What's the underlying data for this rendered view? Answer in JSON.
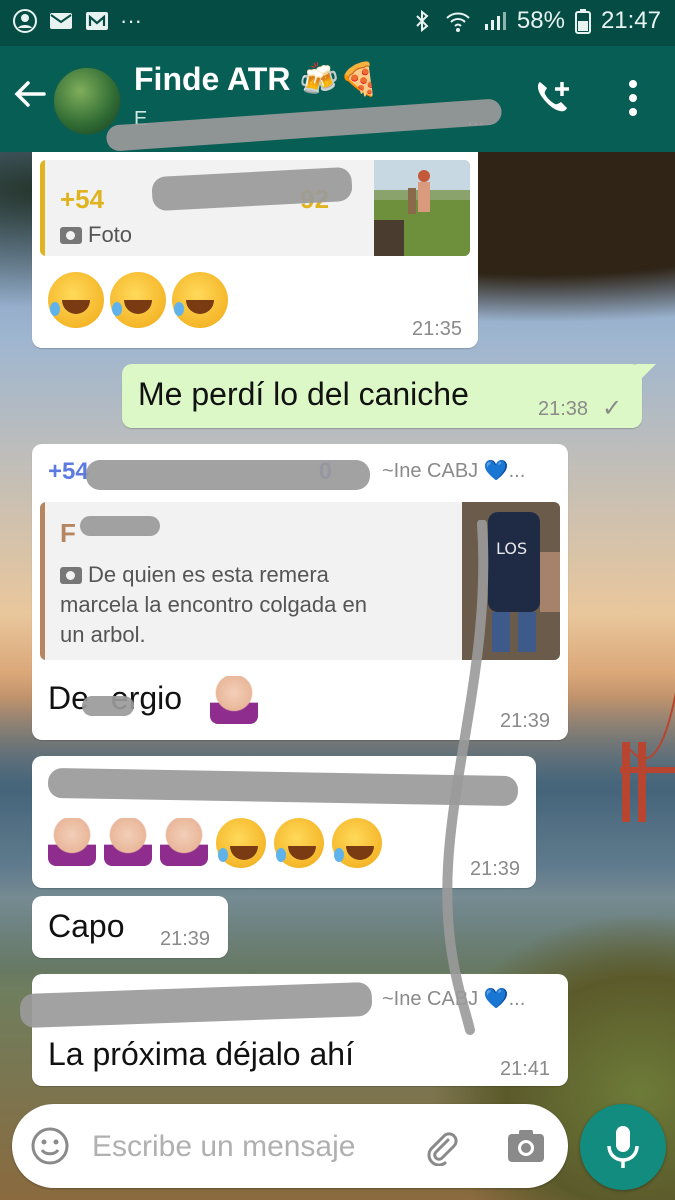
{
  "statusbar": {
    "battery": "58%",
    "time": "21:47",
    "overflow": "···"
  },
  "header": {
    "title": "Finde ATR 🍻🍕",
    "subtitle": "E",
    "subtitle_tail": "...",
    "accent": "#075e54"
  },
  "messages": [
    {
      "quote_sender_prefix": "+54",
      "quote_sender_tail": "92",
      "quote_text": "Foto",
      "time": "21:35"
    },
    {
      "text": "Me perdí lo del caniche",
      "time": "21:38",
      "status": "✓"
    },
    {
      "sender_prefix": "+54",
      "sender_tail": "0",
      "pushname": "~Ine CABJ 💙...",
      "quote_sender": "F",
      "quote_lines": [
        "De quien es esta remera",
        "marcela la encontro colgada en",
        "un arbol."
      ],
      "text": "De Sergio",
      "text_prefix": "De",
      "text_tail": "ergio",
      "time": "21:39"
    },
    {
      "time": "21:39"
    },
    {
      "text": "Capo",
      "time": "21:39"
    },
    {
      "pushname": "~Ine CABJ 💙...",
      "text": "La próxima déjalo ahí",
      "time": "21:41"
    }
  ],
  "input": {
    "placeholder": "Escribe un mensaje"
  },
  "colors": {
    "bubble_out": "#dcf8c6",
    "bubble_in": "#ffffff",
    "sender_blue": "#5c7be0",
    "sender_gold": "#e0b320",
    "quote_brown": "#b58660",
    "fab": "#128c7e"
  }
}
